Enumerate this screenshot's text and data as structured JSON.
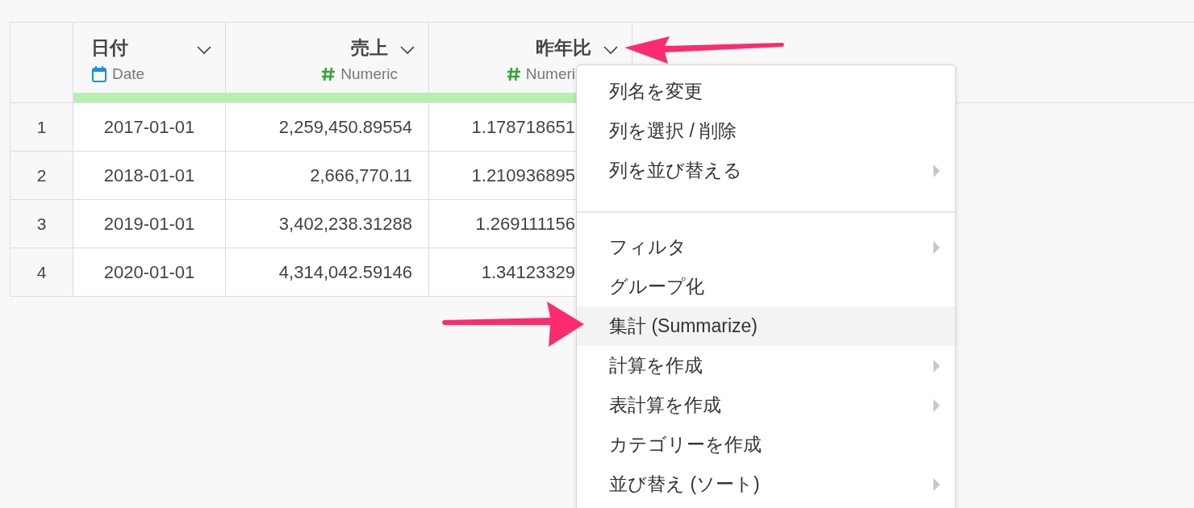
{
  "table": {
    "columns": [
      {
        "name": "日付",
        "type_label": "Date",
        "kind": "date"
      },
      {
        "name": "売上",
        "type_label": "Numeric",
        "kind": "numeric"
      },
      {
        "name": "昨年比",
        "type_label": "Numeri",
        "kind": "numeric"
      }
    ],
    "rows": [
      {
        "number": "1",
        "cells": [
          "2017-01-01",
          "2,259,450.89554",
          "1.178718651"
        ]
      },
      {
        "number": "2",
        "cells": [
          "2018-01-01",
          "2,666,770.11",
          "1.210936895"
        ]
      },
      {
        "number": "3",
        "cells": [
          "2019-01-01",
          "3,402,238.31288",
          "1.269111156"
        ]
      },
      {
        "number": "4",
        "cells": [
          "2020-01-01",
          "4,314,042.59146",
          "1.34123329"
        ]
      }
    ]
  },
  "column_menu": {
    "groups": [
      [
        {
          "label": "列名を変更",
          "submenu": false,
          "selected": false
        },
        {
          "label": "列を選択 / 削除",
          "submenu": false,
          "selected": false
        },
        {
          "label": "列を並び替える",
          "submenu": true,
          "selected": false
        }
      ],
      [
        {
          "label": "フィルタ",
          "submenu": true,
          "selected": false
        },
        {
          "label": "グループ化",
          "submenu": false,
          "selected": false
        },
        {
          "label": "集計 (Summarize)",
          "submenu": false,
          "selected": true
        },
        {
          "label": "計算を作成",
          "submenu": true,
          "selected": false
        },
        {
          "label": "表計算を作成",
          "submenu": true,
          "selected": false
        },
        {
          "label": "カテゴリーを作成",
          "submenu": false,
          "selected": false
        },
        {
          "label": "並び替え (ソート)",
          "submenu": true,
          "selected": false
        }
      ]
    ]
  }
}
